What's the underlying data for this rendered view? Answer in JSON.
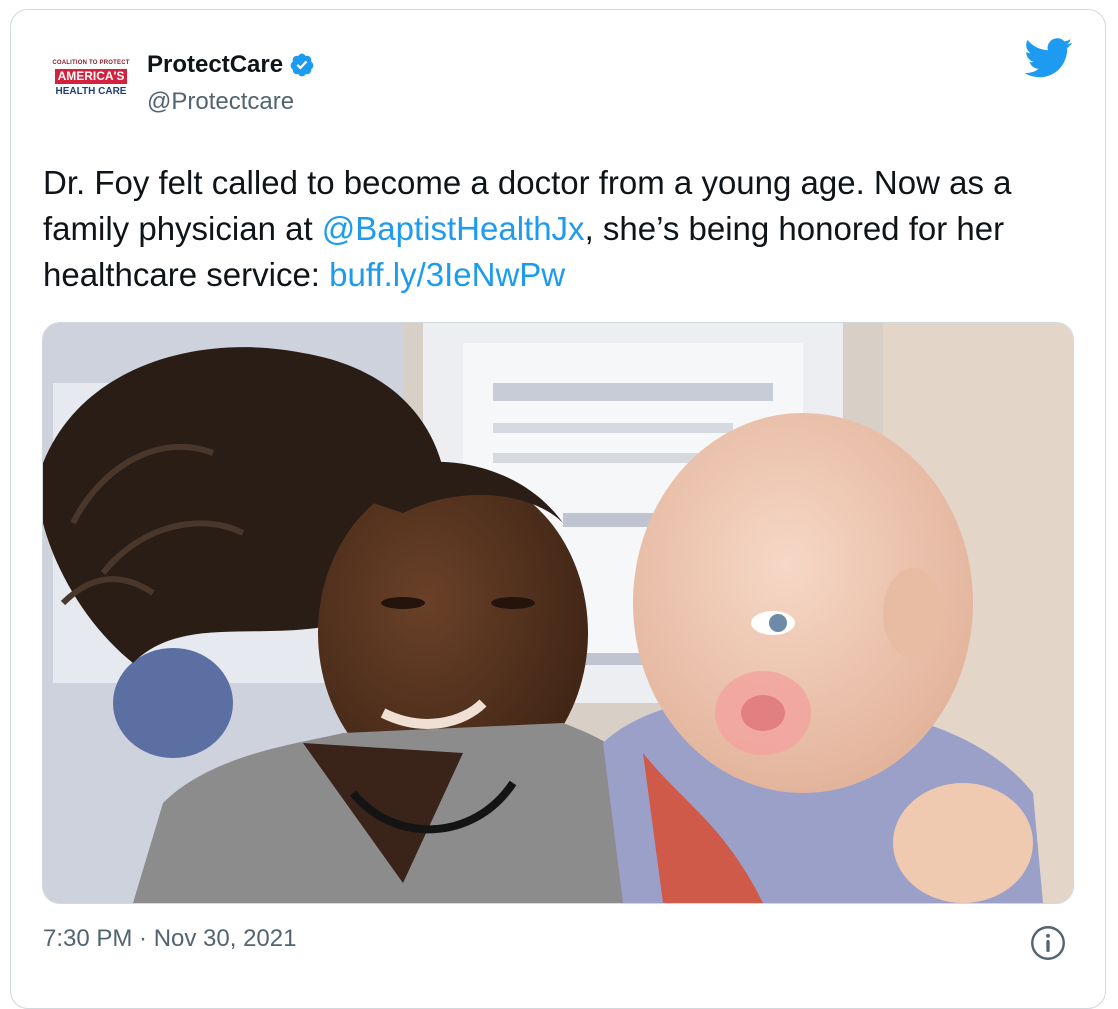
{
  "account": {
    "display_name": "ProtectCare",
    "handle": "@Protectcare",
    "avatar_lines": [
      "COALITION TO PROTECT",
      "AMERICA'S",
      "HEALTH CARE"
    ]
  },
  "tweet": {
    "text_1": "Dr. Foy felt called to become a doctor from a young age. Now as a family physician at ",
    "mention": "@BaptistHealthJx",
    "text_2": ", she’s being honored for her healthcare service: ",
    "link": "buff.ly/3IeNwPw"
  },
  "timestamp": "7:30 PM · Nov 30, 2021",
  "icons": {
    "verified": "verified-badge-icon",
    "bird": "twitter-bird-icon",
    "info": "info-icon"
  },
  "colors": {
    "link": "#1d9bf0",
    "secondary_text": "#536471",
    "border": "#cfd9de"
  }
}
